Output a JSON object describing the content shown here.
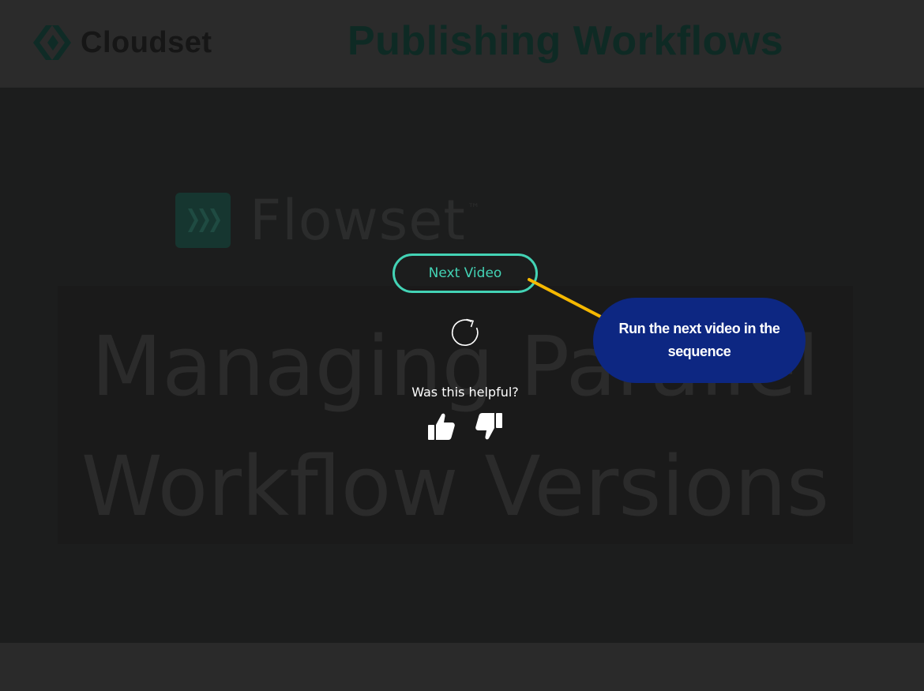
{
  "header": {
    "brand_name": "Cloudset",
    "page_title": "Publishing Workflows"
  },
  "video": {
    "logo_text": "Flowset",
    "logo_tm": "™",
    "title_card": "Managing Parallel Workflow Versions"
  },
  "end_screen": {
    "next_video_label": "Next Video",
    "helpful_prompt": "Was this helpful?"
  },
  "callout": {
    "text": "Run the next video in the sequence"
  },
  "icons": {
    "brand": "cloudset-logo-icon",
    "video_logo": "flowset-logo-icon",
    "replay": "replay-icon",
    "thumbs_up": "thumbs-up-icon",
    "thumbs_down": "thumbs-down-icon"
  },
  "colors": {
    "accent": "#43d3b5",
    "callout_bg": "#0d2782",
    "callout_line": "#f5b800",
    "header_bg": "#2b2b2b",
    "player_bg": "#1c1d1d"
  }
}
